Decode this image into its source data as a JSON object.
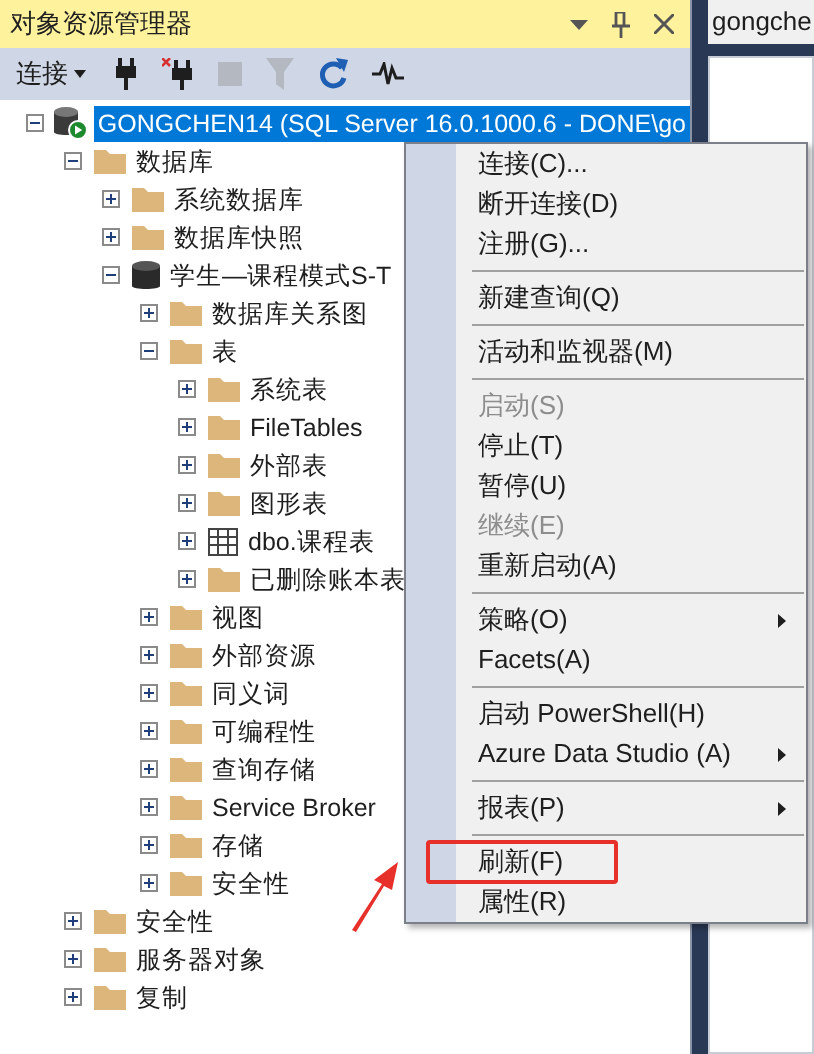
{
  "panel": {
    "title": "对象资源管理器",
    "buttons": [
      {
        "kind": "dropdown"
      },
      {
        "kind": "pin"
      },
      {
        "kind": "close"
      }
    ]
  },
  "toolbar": [
    {
      "kind": "connect",
      "label": "连接",
      "disabled": false
    },
    {
      "kind": "plug",
      "disabled": false
    },
    {
      "kind": "disconnect",
      "disabled": false
    },
    {
      "kind": "stop",
      "disabled": true
    },
    {
      "kind": "filter",
      "disabled": true
    },
    {
      "kind": "refresh",
      "disabled": false
    },
    {
      "kind": "activity",
      "disabled": false
    }
  ],
  "tree": [
    {
      "kind": "server",
      "label": "GONGCHEN14 (SQL Server 16.0.1000.6 - DONE\\go",
      "expanded": true,
      "selected": true,
      "children": [
        {
          "kind": "folder",
          "label": "数据库",
          "expanded": true,
          "selected": false,
          "children": [
            {
              "kind": "folder",
              "label": "系统数据库",
              "expanded": false,
              "selected": false
            },
            {
              "kind": "folder",
              "label": "数据库快照",
              "expanded": false,
              "selected": false
            },
            {
              "kind": "database",
              "label": "学生—课程模式S-T",
              "expanded": true,
              "selected": false,
              "children": [
                {
                  "kind": "folder",
                  "label": "数据库关系图",
                  "expanded": false,
                  "selected": false
                },
                {
                  "kind": "folder",
                  "label": "表",
                  "expanded": true,
                  "selected": false,
                  "children": [
                    {
                      "kind": "folder",
                      "label": "系统表",
                      "expanded": false,
                      "selected": false
                    },
                    {
                      "kind": "folder",
                      "label": "FileTables",
                      "expanded": false,
                      "selected": false
                    },
                    {
                      "kind": "folder",
                      "label": "外部表",
                      "expanded": false,
                      "selected": false
                    },
                    {
                      "kind": "folder",
                      "label": "图形表",
                      "expanded": false,
                      "selected": false
                    },
                    {
                      "kind": "table",
                      "label": "dbo.课程表",
                      "expanded": false,
                      "selected": false
                    },
                    {
                      "kind": "folder",
                      "label": "已删除账本表",
                      "expanded": false,
                      "selected": false
                    }
                  ]
                },
                {
                  "kind": "folder",
                  "label": "视图",
                  "expanded": false,
                  "selected": false
                },
                {
                  "kind": "folder",
                  "label": "外部资源",
                  "expanded": false,
                  "selected": false
                },
                {
                  "kind": "folder",
                  "label": "同义词",
                  "expanded": false,
                  "selected": false
                },
                {
                  "kind": "folder",
                  "label": "可编程性",
                  "expanded": false,
                  "selected": false
                },
                {
                  "kind": "folder",
                  "label": "查询存储",
                  "expanded": false,
                  "selected": false
                },
                {
                  "kind": "folder",
                  "label": "Service Broker",
                  "expanded": false,
                  "selected": false
                },
                {
                  "kind": "folder",
                  "label": "存储",
                  "expanded": false,
                  "selected": false
                },
                {
                  "kind": "folder",
                  "label": "安全性",
                  "expanded": false,
                  "selected": false
                }
              ]
            }
          ]
        },
        {
          "kind": "folder",
          "label": "安全性",
          "expanded": false,
          "selected": false
        },
        {
          "kind": "folder",
          "label": "服务器对象",
          "expanded": false,
          "selected": false
        },
        {
          "kind": "folder",
          "label": "复制",
          "expanded": false,
          "selected": false
        }
      ]
    }
  ],
  "context_menu": [
    {
      "kind": "item",
      "label": "连接(C)...",
      "disabled": false,
      "submenu": false,
      "marked": false
    },
    {
      "kind": "item",
      "label": "断开连接(D)",
      "disabled": false,
      "submenu": false,
      "marked": false
    },
    {
      "kind": "item",
      "label": "注册(G)...",
      "disabled": false,
      "submenu": false,
      "marked": false
    },
    {
      "kind": "separator"
    },
    {
      "kind": "item",
      "label": "新建查询(Q)",
      "disabled": false,
      "submenu": false,
      "marked": false
    },
    {
      "kind": "separator"
    },
    {
      "kind": "item",
      "label": "活动和监视器(M)",
      "disabled": false,
      "submenu": false,
      "marked": false
    },
    {
      "kind": "separator"
    },
    {
      "kind": "item",
      "label": "启动(S)",
      "disabled": true,
      "submenu": false,
      "marked": false
    },
    {
      "kind": "item",
      "label": "停止(T)",
      "disabled": false,
      "submenu": false,
      "marked": false
    },
    {
      "kind": "item",
      "label": "暂停(U)",
      "disabled": false,
      "submenu": false,
      "marked": false
    },
    {
      "kind": "item",
      "label": "继续(E)",
      "disabled": true,
      "submenu": false,
      "marked": false
    },
    {
      "kind": "item",
      "label": "重新启动(A)",
      "disabled": false,
      "submenu": false,
      "marked": false
    },
    {
      "kind": "separator"
    },
    {
      "kind": "item",
      "label": "策略(O)",
      "disabled": false,
      "submenu": true,
      "marked": false
    },
    {
      "kind": "item",
      "label": "Facets(A)",
      "disabled": false,
      "submenu": false,
      "marked": false
    },
    {
      "kind": "separator"
    },
    {
      "kind": "item",
      "label": "启动 PowerShell(H)",
      "disabled": false,
      "submenu": false,
      "marked": false
    },
    {
      "kind": "item",
      "label": "Azure Data Studio (A)",
      "disabled": false,
      "submenu": true,
      "marked": false
    },
    {
      "kind": "separator"
    },
    {
      "kind": "item",
      "label": "报表(P)",
      "disabled": false,
      "submenu": true,
      "marked": false
    },
    {
      "kind": "separator"
    },
    {
      "kind": "item",
      "label": "刷新(F)",
      "disabled": false,
      "submenu": false,
      "marked": true
    },
    {
      "kind": "item",
      "label": "属性(R)",
      "disabled": false,
      "submenu": false,
      "marked": false
    }
  ],
  "document_tab": {
    "label": "gongche"
  }
}
